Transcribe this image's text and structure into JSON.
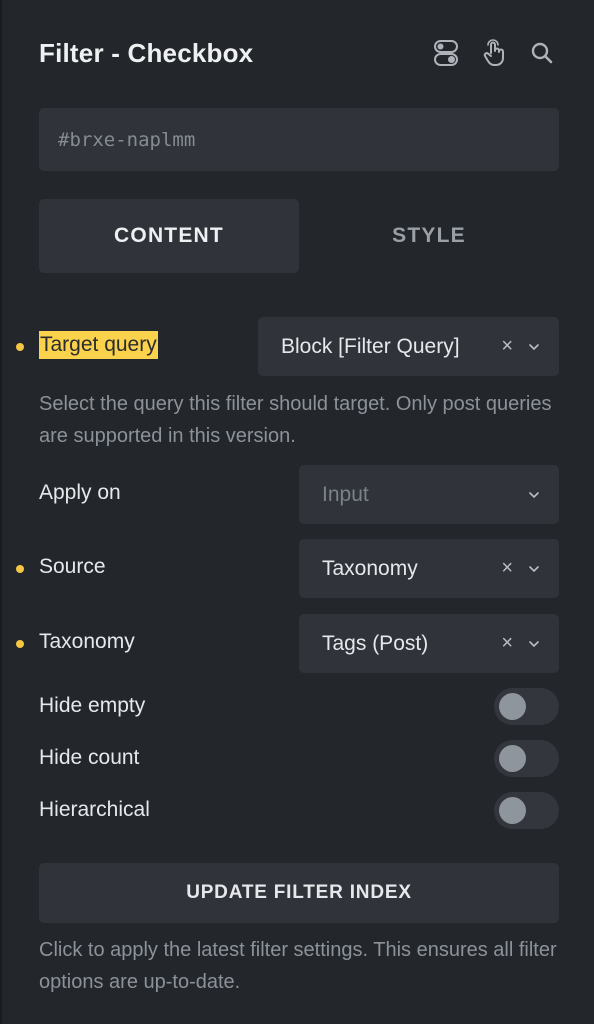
{
  "header": {
    "title": "Filter - Checkbox",
    "icons": [
      "toggle-switches-icon",
      "hand-pointer-icon",
      "search-icon"
    ]
  },
  "element_id": {
    "value": "#brxe-naplmm"
  },
  "tabs": [
    {
      "label": "CONTENT",
      "active": true
    },
    {
      "label": "STYLE",
      "active": false
    }
  ],
  "fields": {
    "target_query": {
      "label": "Target query",
      "value": "Block [Filter Query]",
      "clear": "×",
      "description": "Select the query this filter should target. Only post queries are supported in this version."
    },
    "apply_on": {
      "label": "Apply on",
      "placeholder": "Input"
    },
    "source": {
      "label": "Source",
      "value": "Taxonomy",
      "clear": "×"
    },
    "taxonomy": {
      "label": "Taxonomy",
      "value": "Tags (Post)",
      "clear": "×"
    },
    "hide_empty": {
      "label": "Hide empty",
      "on": false
    },
    "hide_count": {
      "label": "Hide count",
      "on": false
    },
    "hierarchical": {
      "label": "Hierarchical",
      "on": false
    }
  },
  "update_button": {
    "label": "UPDATE FILTER INDEX",
    "description": "Click to apply the latest filter settings. This ensures all filter options are up-to-date."
  },
  "colors": {
    "background": "#23262b",
    "field": "#30343a",
    "accent_dot": "#f5c544",
    "highlight": "#fbd24b"
  }
}
